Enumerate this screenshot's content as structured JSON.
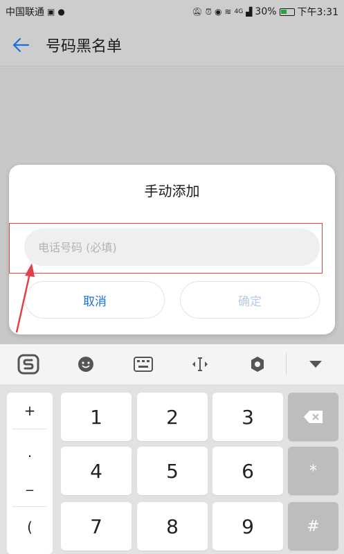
{
  "status_bar": {
    "carrier": "中国联通",
    "signal_label": "4G",
    "battery": "30%",
    "time": "下午3:31"
  },
  "header": {
    "title": "号码黑名单"
  },
  "dialog": {
    "title": "手动添加",
    "input_placeholder": "电话号码 (必填)",
    "input_value": "",
    "cancel_label": "取消",
    "confirm_label": "确定"
  },
  "keyboard": {
    "side_keys": [
      "+",
      ".",
      "_",
      "("
    ],
    "digits": [
      "1",
      "2",
      "3",
      "4",
      "5",
      "6",
      "7",
      "8",
      "9"
    ],
    "star_label": "*",
    "hash_label": "#",
    "toolbar_icons": [
      "sogou-logo-icon",
      "emoji-icon",
      "keyboard-icon",
      "cursor-move-icon",
      "settings-icon",
      "collapse-icon"
    ]
  },
  "colors": {
    "accent": "#1a6fd8",
    "highlight": "#e0424a",
    "disabled": "#b9c9e6"
  }
}
